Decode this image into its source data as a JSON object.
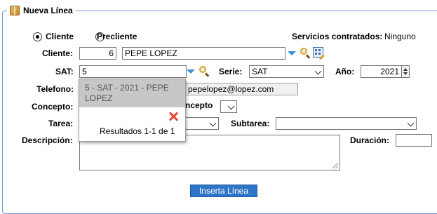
{
  "panel": {
    "legend": "Nueva Línea"
  },
  "mode": {
    "cliente_label": "Cliente",
    "precliente_label": "Precliente",
    "selected": "Cliente"
  },
  "servicios": {
    "label": "Servicios contratados:",
    "value": "Ninguno"
  },
  "cliente": {
    "label": "Cliente:",
    "code": "6",
    "name": "PEPE LOPEZ"
  },
  "sat": {
    "label": "SAT:",
    "value": "5"
  },
  "serie": {
    "label": "Serie:",
    "value": "SAT"
  },
  "anio": {
    "label": "Año:",
    "value": "2021"
  },
  "telefono": {
    "label": "Telefono:",
    "email": "pepelopez@lopez.com"
  },
  "concepto": {
    "label": "Concepto:",
    "label2": "ncepto"
  },
  "tarea": {
    "label": "Tarea:"
  },
  "subtarea": {
    "label": "Subtarea:"
  },
  "descripcion": {
    "label": "Descripción:"
  },
  "duracion": {
    "label": "Duración:"
  },
  "autocomplete": {
    "item": "5 - SAT - 2021 - PEPE LOPEZ",
    "results": "Resultados 1-1 de 1"
  },
  "actions": {
    "insert_label": "Inserta Línea"
  },
  "colors": {
    "accent": "#2e74c8",
    "frame": "#6f9ad3"
  }
}
